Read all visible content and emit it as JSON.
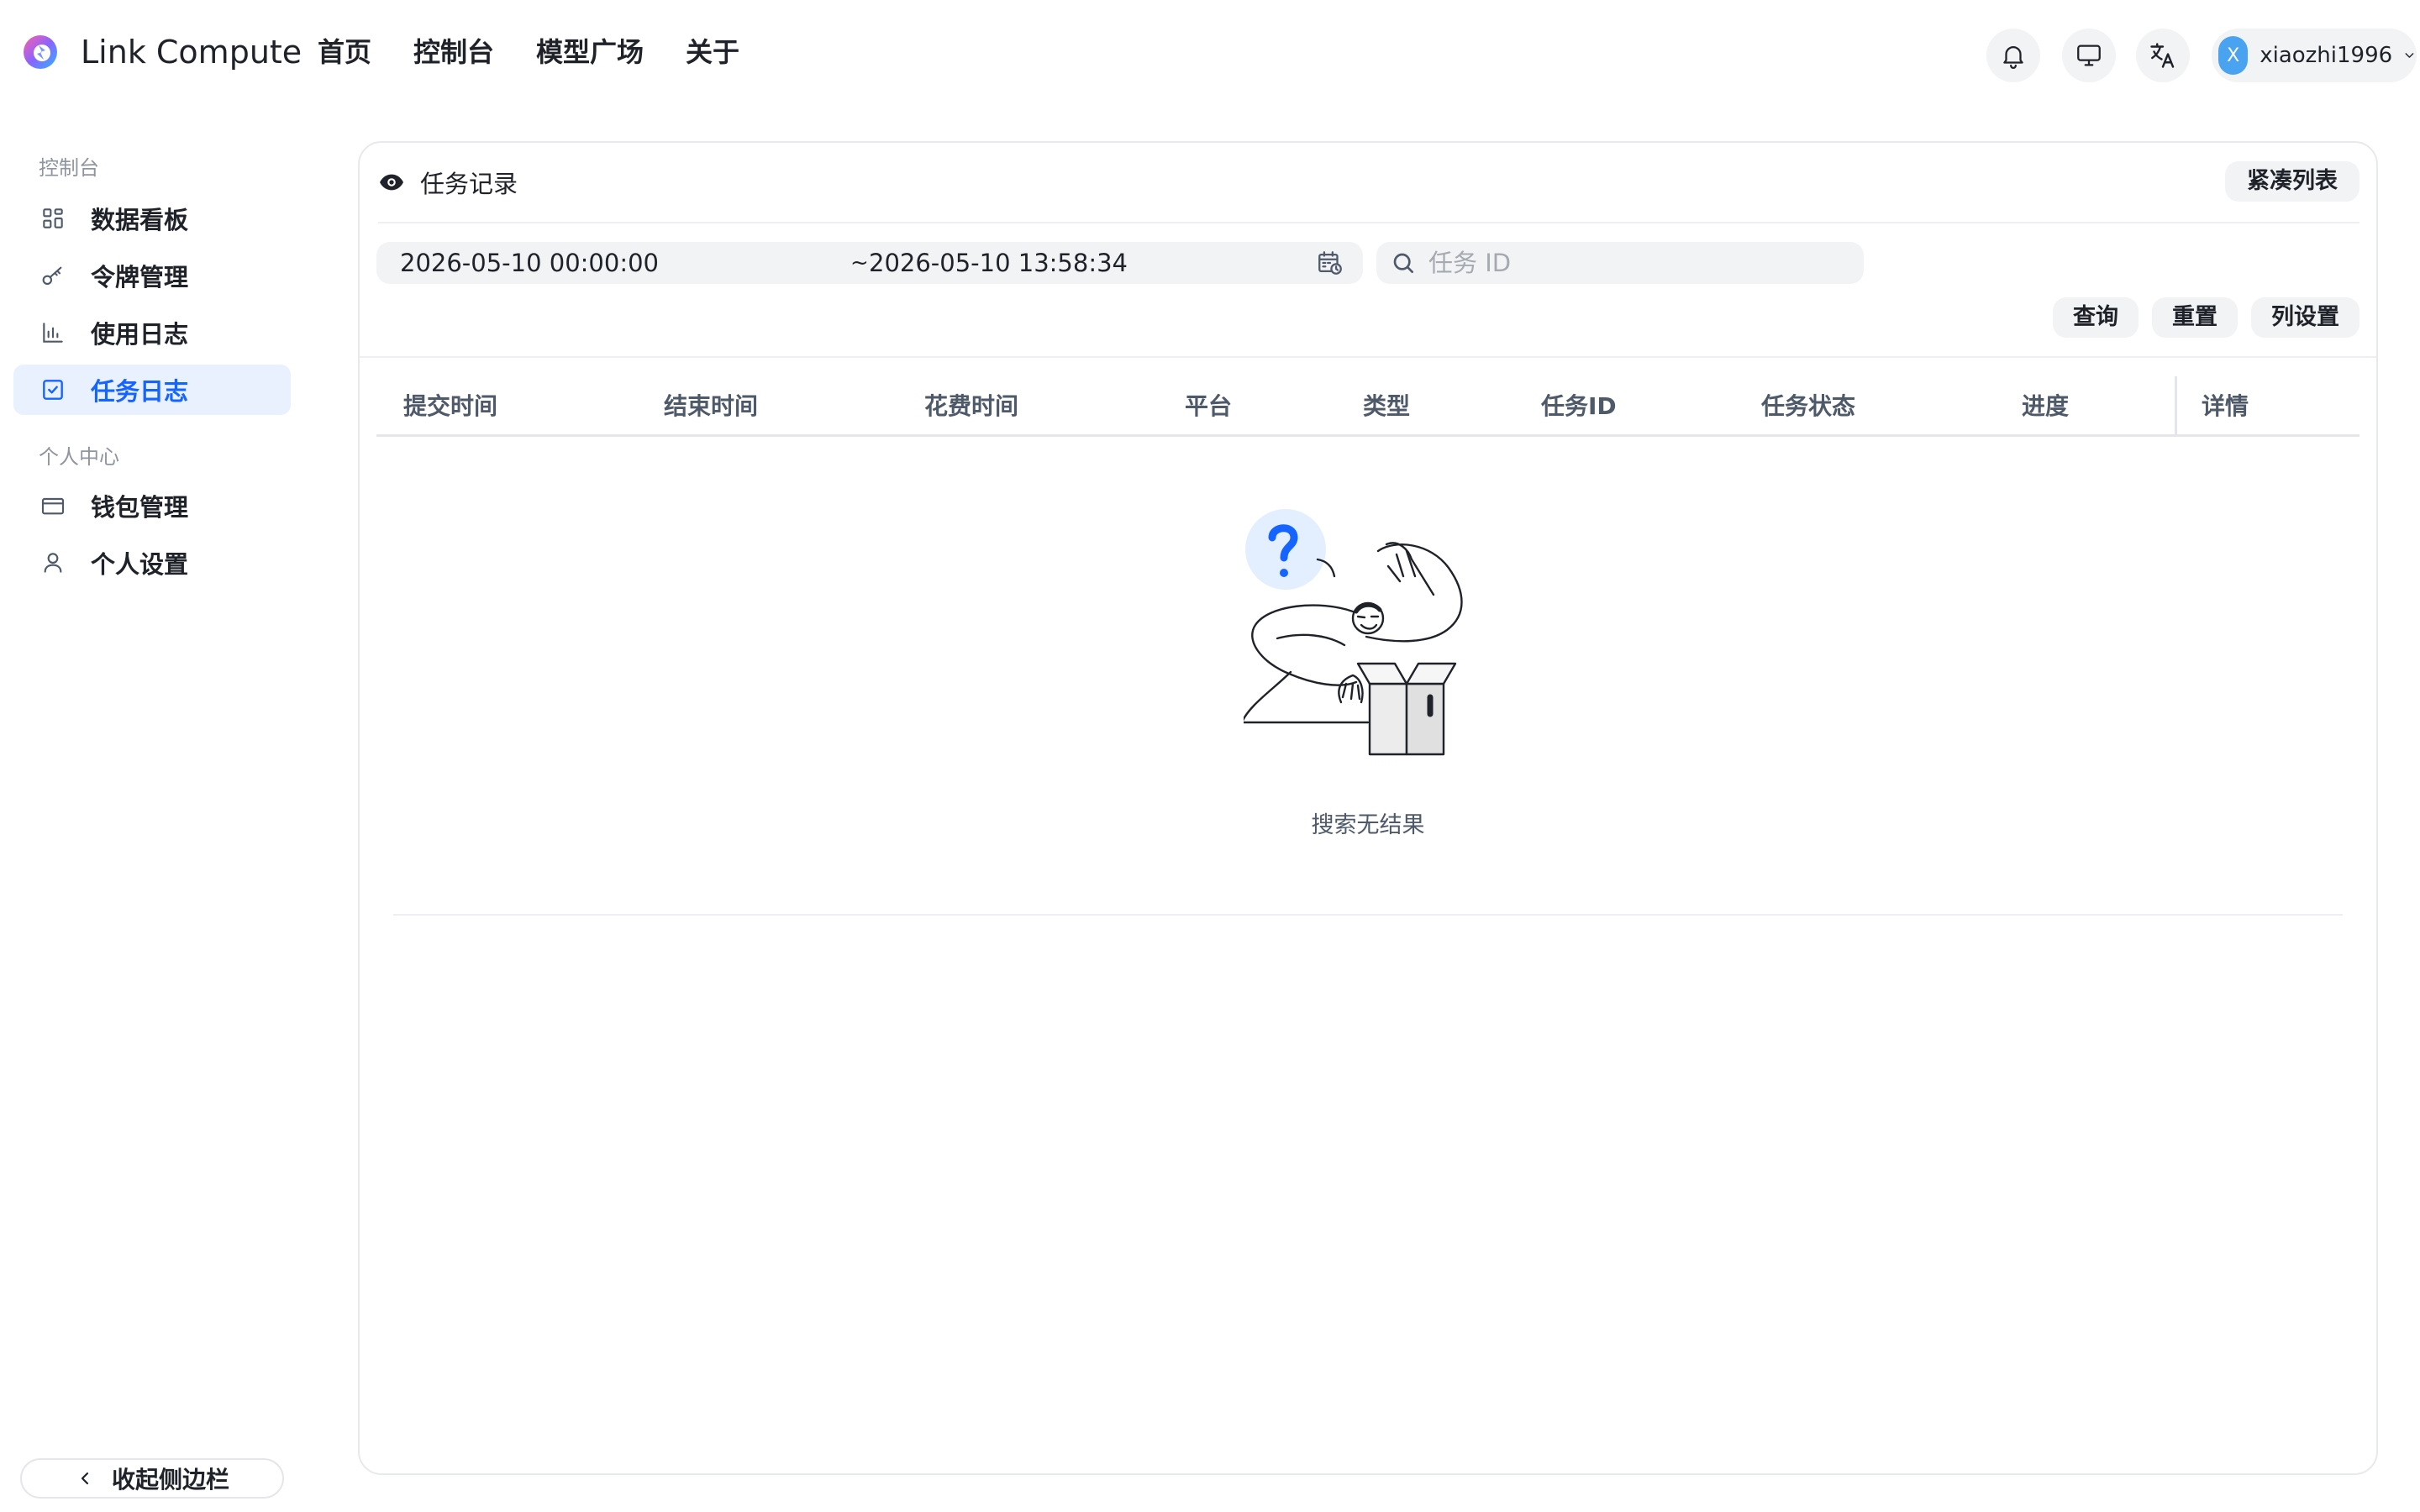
{
  "app": {
    "title": "Link Compute"
  },
  "topnav": [
    "首页",
    "控制台",
    "模型广场",
    "关于"
  ],
  "user": {
    "initial": "X",
    "name": "xiaozhi1996"
  },
  "sidebar": {
    "group_console": "控制台",
    "items_console": [
      {
        "label": "数据看板",
        "icon": "dashboard-icon"
      },
      {
        "label": "令牌管理",
        "icon": "key-icon"
      },
      {
        "label": "使用日志",
        "icon": "bar-chart-icon"
      },
      {
        "label": "任务日志",
        "icon": "checkbox-icon",
        "active": true
      }
    ],
    "group_personal": "个人中心",
    "items_personal": [
      {
        "label": "钱包管理",
        "icon": "wallet-icon"
      },
      {
        "label": "个人设置",
        "icon": "user-icon"
      }
    ],
    "collapse_label": "收起侧边栏"
  },
  "panel": {
    "title": "任务记录",
    "compact_label": "紧凑列表",
    "date_start": "2026-05-10 00:00:00",
    "date_sep": "~",
    "date_end": "2026-05-10 13:58:34",
    "search_placeholder": "任务 ID",
    "search_value": "",
    "actions": {
      "query": "查询",
      "reset": "重置",
      "columns": "列设置"
    },
    "columns": [
      "提交时间",
      "结束时间",
      "花费时间",
      "平台",
      "类型",
      "任务ID",
      "任务状态",
      "进度",
      "详情"
    ],
    "empty_text": "搜索无结果"
  },
  "colors": {
    "accent": "#1664ff",
    "active_bg": "#e9f1ff",
    "control_bg": "#f2f3f5"
  }
}
